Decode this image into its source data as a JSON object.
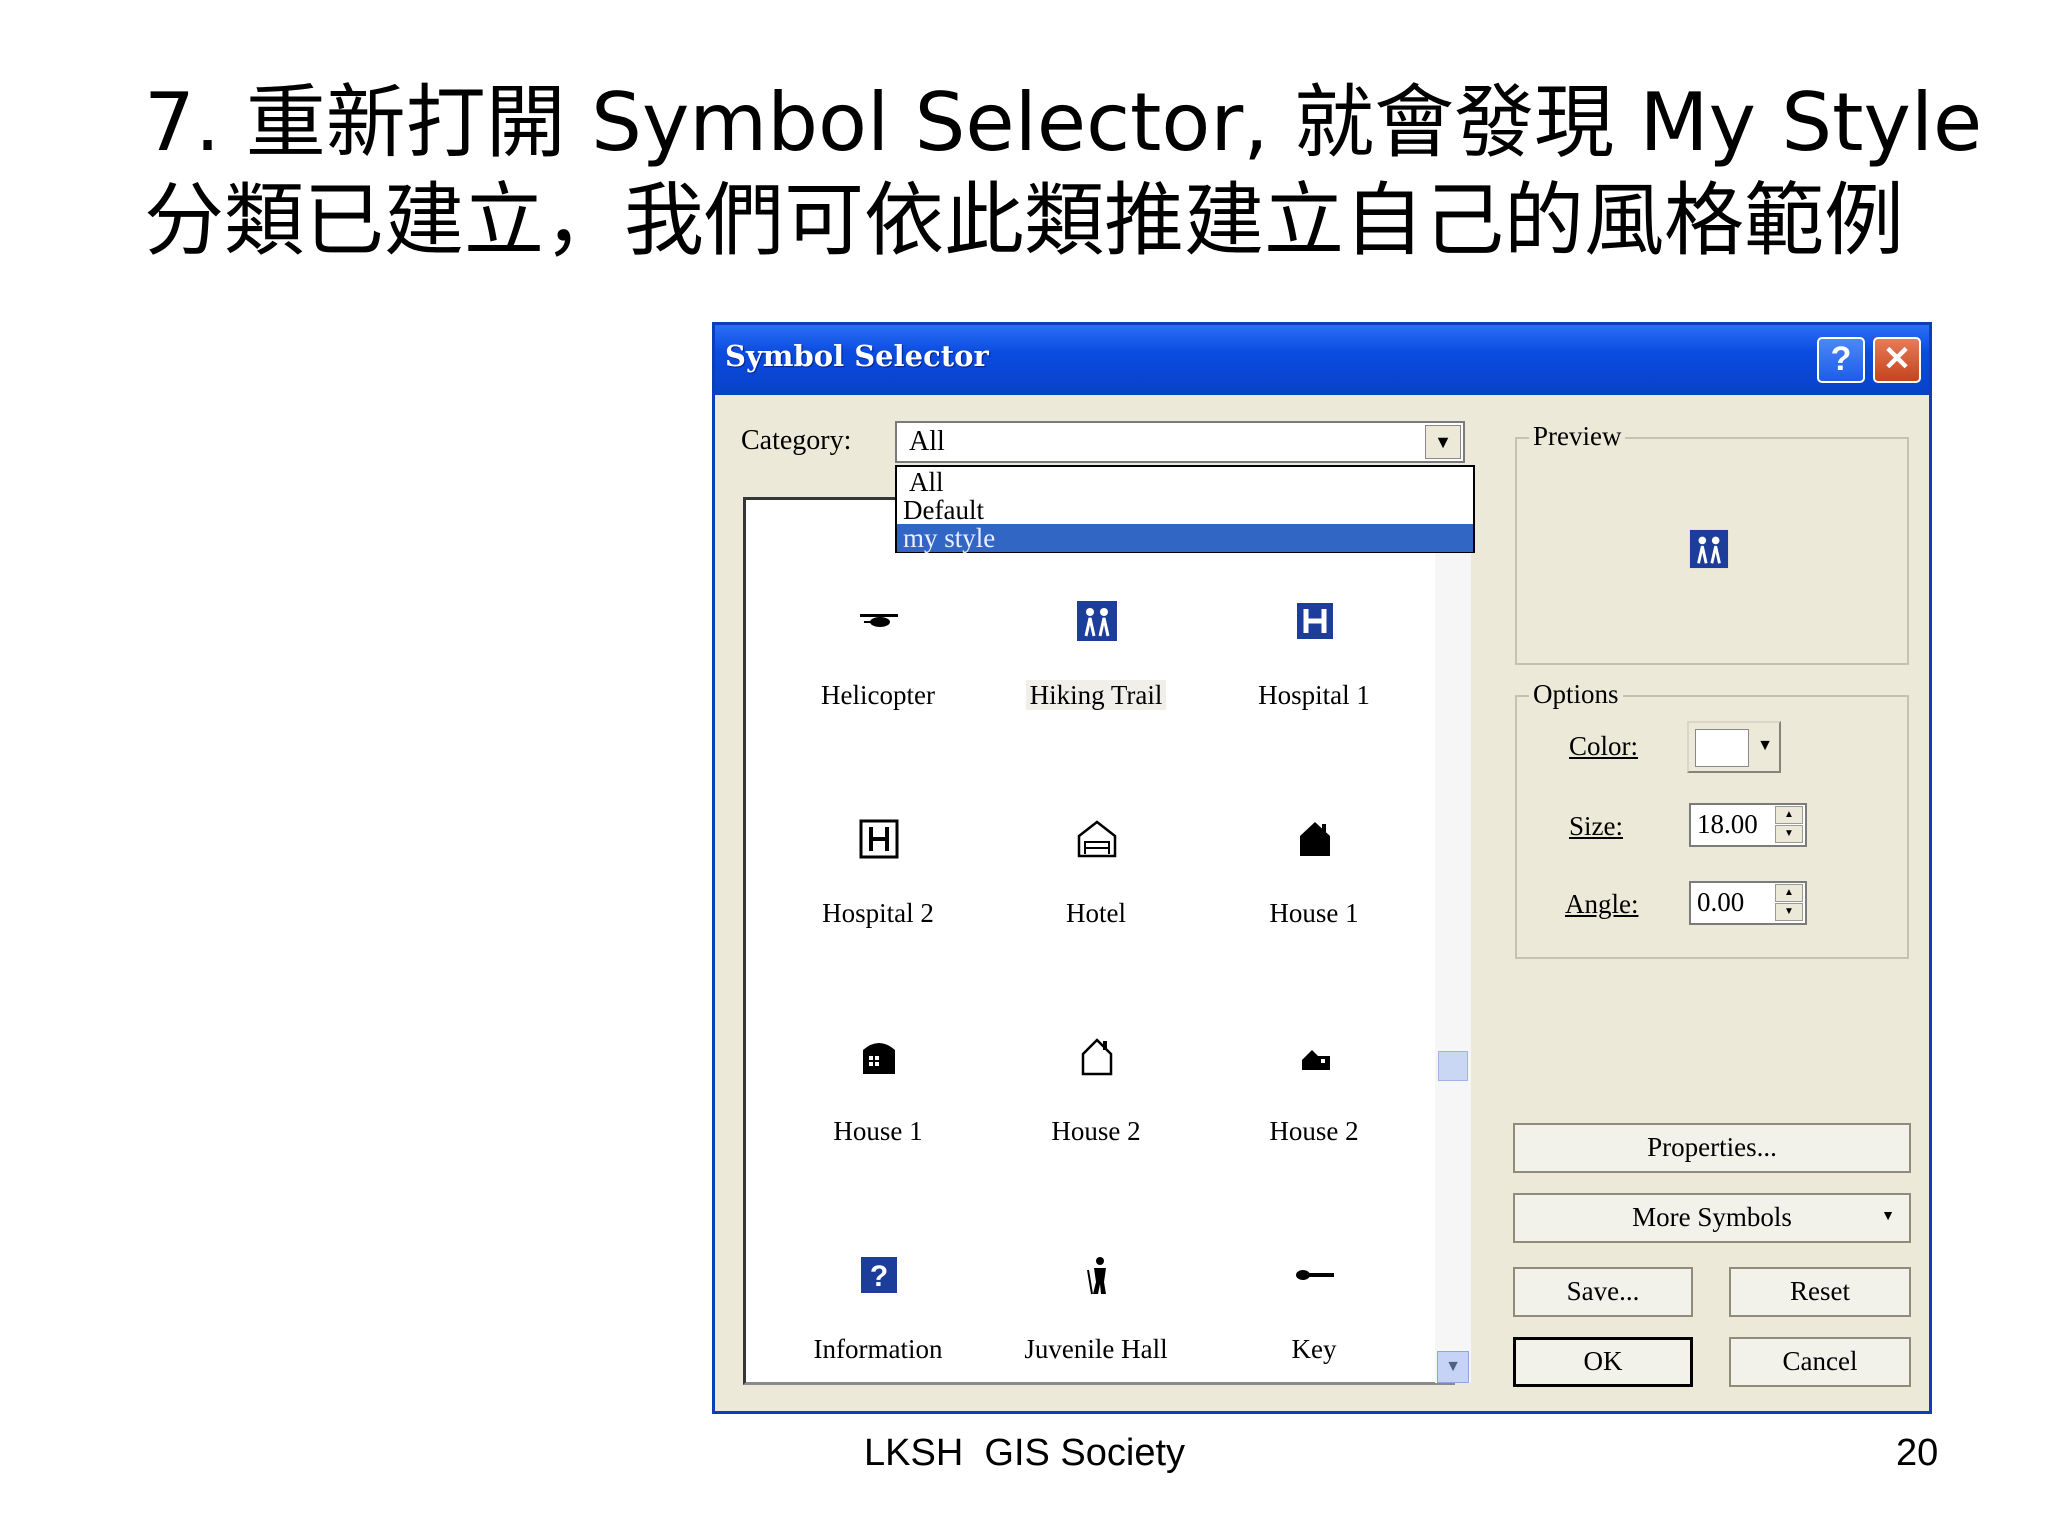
{
  "slide": {
    "title_line1": "7. 重新打開 Symbol Selector, 就會發現 My Style",
    "title_line2": "分類已建立，我們可依此類推建立自己的風格範例",
    "footer_left": "LKSH  GIS Society",
    "page_number": "20"
  },
  "dialog": {
    "title": "Symbol Selector",
    "help_icon": "?",
    "close_icon": "✕",
    "category_label": "Category:",
    "category_value": "All",
    "dropdown_options": [
      "All",
      "Default",
      "my style"
    ],
    "selected_option": "my style",
    "symbols": [
      {
        "label": "Helicopter",
        "icon": "helicopter-icon"
      },
      {
        "label": "Hiking Trail",
        "icon": "hiking-trail-icon"
      },
      {
        "label": "Hospital 1",
        "icon": "hospital-filled-icon"
      },
      {
        "label": "Hospital 2",
        "icon": "hospital-outline-icon"
      },
      {
        "label": "Hotel",
        "icon": "hotel-icon"
      },
      {
        "label": "House 1",
        "icon": "house-filled-icon"
      },
      {
        "label": "House 1",
        "icon": "house-building-icon"
      },
      {
        "label": "House 2",
        "icon": "house-outline-icon"
      },
      {
        "label": "House 2",
        "icon": "house-small-icon"
      },
      {
        "label": "Information",
        "icon": "information-icon"
      },
      {
        "label": "Juvenile Hall",
        "icon": "juvenile-hall-icon"
      },
      {
        "label": "Key",
        "icon": "key-icon"
      }
    ],
    "preview_label": "Preview",
    "options_label": "Options",
    "color_label": "Color:",
    "size_label": "Size:",
    "size_value": "18.00",
    "angle_label": "Angle:",
    "angle_value": "0.00",
    "properties_button": "Properties...",
    "more_symbols_button": "More Symbols",
    "save_button": "Save...",
    "reset_button": "Reset",
    "ok_button": "OK",
    "cancel_button": "Cancel"
  }
}
